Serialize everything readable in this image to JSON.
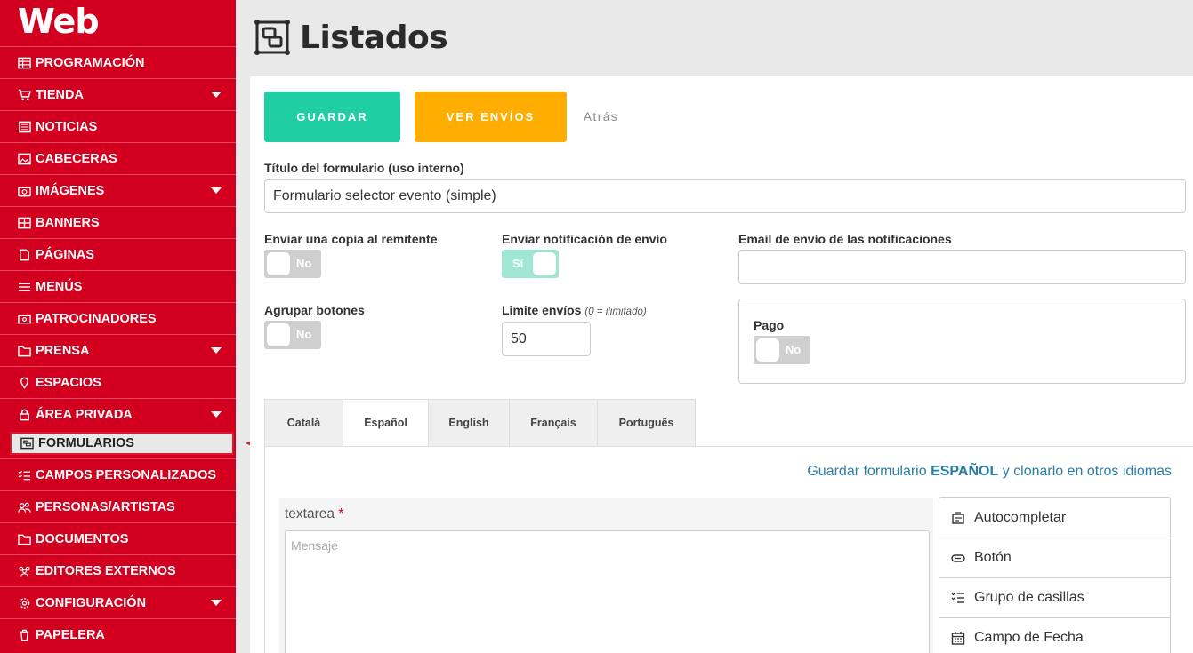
{
  "sidebar": {
    "brand": "Web",
    "items": [
      {
        "label": "PROGRAMACIÓN",
        "icon": "table-icon"
      },
      {
        "label": "TIENDA",
        "icon": "cart-icon"
      },
      {
        "label": "NOTICIAS",
        "icon": "newspaper-icon"
      },
      {
        "label": "CABECERAS",
        "icon": "image-icon"
      },
      {
        "label": "IMÁGENES",
        "icon": "camera-icon"
      },
      {
        "label": "BANNERS",
        "icon": "grid-icon"
      },
      {
        "label": "PÁGINAS",
        "icon": "file-icon"
      },
      {
        "label": "MENÚS",
        "icon": "menu-icon"
      },
      {
        "label": "PATROCINADORES",
        "icon": "money-icon"
      },
      {
        "label": "PRENSA",
        "icon": "folder-icon"
      },
      {
        "label": "ESPACIOS",
        "icon": "pin-icon"
      },
      {
        "label": "ÁREA PRIVADA",
        "icon": "lock-icon"
      },
      {
        "label": "FORMULARIOS",
        "icon": "form-icon"
      },
      {
        "label": "CAMPOS PERSONALIZADOS",
        "icon": "checklist-icon"
      },
      {
        "label": "PERSONAS/ARTISTAS",
        "icon": "users-icon"
      },
      {
        "label": "DOCUMENTOS",
        "icon": "folder-icon"
      },
      {
        "label": "EDITORES EXTERNOS",
        "icon": "group-icon"
      },
      {
        "label": "CONFIGURACIÓN",
        "icon": "gear-icon"
      },
      {
        "label": "PAPELERA",
        "icon": "trash-icon"
      }
    ]
  },
  "header": {
    "title": "Listados",
    "icon": "form-icon"
  },
  "actions": {
    "save": "GUARDAR",
    "view_submissions": "VER ENVÍOS",
    "back": "Atrás"
  },
  "form": {
    "title_label": "Título del formulario (uso interno)",
    "title_value": "Formulario selector evento (simple)",
    "copy_sender_label": "Enviar una copia al remitente",
    "copy_sender_state": "No",
    "notify_label": "Enviar notificación de envío",
    "notify_state": "Sí",
    "email_label": "Email de envío de las notificaciones",
    "email_value": "",
    "group_buttons_label": "Agrupar botones",
    "group_buttons_state": "No",
    "limit_label": "Limite envíos",
    "limit_hint": "(0 = ilimitado)",
    "limit_value": "50",
    "payment_label": "Pago",
    "payment_state": "No"
  },
  "tabs": [
    {
      "label": "Català"
    },
    {
      "label": "Español",
      "active": true
    },
    {
      "label": "English"
    },
    {
      "label": "Français"
    },
    {
      "label": "Português"
    }
  ],
  "clone": {
    "prefix": "Guardar formulario",
    "lang": "ESPAÑOL",
    "suffix": "y clonarlo en otros idiomas"
  },
  "field": {
    "label": "textarea",
    "required_mark": "*",
    "placeholder": "Mensaje"
  },
  "widgets": [
    {
      "label": "Autocompletar",
      "icon": "autocomplete-icon"
    },
    {
      "label": "Botón",
      "icon": "button-icon"
    },
    {
      "label": "Grupo de casillas",
      "icon": "checklist-icon"
    },
    {
      "label": "Campo de Fecha",
      "icon": "calendar-icon"
    }
  ],
  "colors": {
    "sidebar": "#d2001e",
    "save": "#1fcfa3",
    "envios": "#ffad00",
    "link": "#2a7ea6"
  }
}
